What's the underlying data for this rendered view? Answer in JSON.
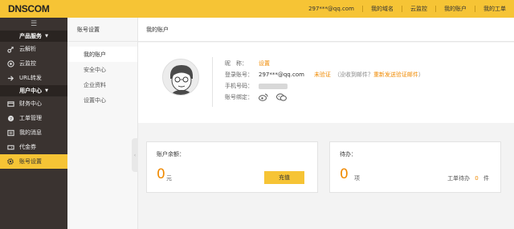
{
  "brand": {
    "logo": "DNSCOM"
  },
  "top_nav": [
    "297***@qq.com",
    "我的域名",
    "云监控",
    "我的账户",
    "我的工单"
  ],
  "sidebar": {
    "section1": "产品服务",
    "items1": [
      {
        "label": "云解析",
        "icon": "dns-icon"
      },
      {
        "label": "云监控",
        "icon": "monitor-icon"
      },
      {
        "label": "URL转发",
        "icon": "forward-icon"
      }
    ],
    "section2": "用户中心",
    "items2": [
      {
        "label": "财务中心",
        "icon": "finance-icon"
      },
      {
        "label": "工单管理",
        "icon": "ticket-icon"
      },
      {
        "label": "我的消息",
        "icon": "message-icon"
      },
      {
        "label": "代金券",
        "icon": "coupon-icon"
      },
      {
        "label": "账号设置",
        "icon": "gear-icon"
      }
    ]
  },
  "subnav": {
    "title": "账号设置",
    "items": [
      "我的账户",
      "安全中心",
      "企业资料",
      "设置中心"
    ]
  },
  "page": {
    "title": "我的账户"
  },
  "profile": {
    "nickname_label": "昵　称：",
    "nickname_value": "设置",
    "login_label": "登录账号：",
    "login_value": "297***@qq.com",
    "verify_status": "未验证",
    "verify_hint": "（没收到邮件？",
    "resend_link": "重新发送验证邮件",
    "verify_hint_end": "）",
    "phone_label": "手机号码：",
    "bind_label": "账号绑定："
  },
  "balance": {
    "title": "账户余额：",
    "value": "0",
    "unit": "元",
    "button": "充值"
  },
  "todo": {
    "title": "待办：",
    "value": "0",
    "unit": "项",
    "ticket_label": "工单待办",
    "ticket_count": "0",
    "ticket_unit": "件"
  },
  "colors": {
    "accent": "#f6c435",
    "sidebar": "#3a3330",
    "highlight": "#f08a00"
  }
}
